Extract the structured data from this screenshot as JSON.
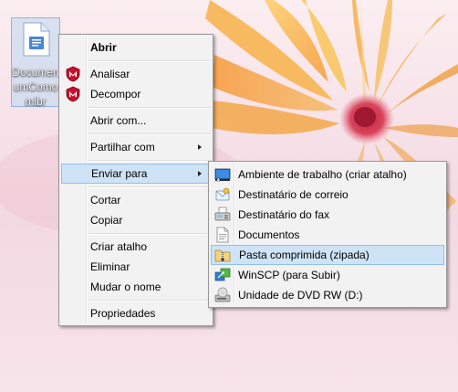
{
  "desktop": {
    "file_label_line1": "Documen",
    "file_label_line2": "umComo",
    "file_label_line3": "mibr"
  },
  "context_menu": {
    "items": [
      {
        "label": "Abrir",
        "icon": "none"
      },
      {
        "label": "Analisar",
        "icon": "mcafee-shield-icon"
      },
      {
        "label": "Decompor",
        "icon": "mcafee-shield-icon"
      },
      {
        "label": "Abrir com...",
        "icon": "none"
      },
      {
        "label": "Partilhar com",
        "icon": "none",
        "submenu": true
      },
      {
        "label": "Enviar para",
        "icon": "none",
        "submenu": true,
        "highlighted": true
      },
      {
        "label": "Cortar",
        "icon": "none"
      },
      {
        "label": "Copiar",
        "icon": "none"
      },
      {
        "label": "Criar atalho",
        "icon": "none"
      },
      {
        "label": "Eliminar",
        "icon": "none"
      },
      {
        "label": "Mudar o nome",
        "icon": "none"
      },
      {
        "label": "Propriedades",
        "icon": "none"
      }
    ]
  },
  "send_to_menu": {
    "items": [
      {
        "label": "Ambiente de trabalho (criar atalho)",
        "icon": "desktop-icon"
      },
      {
        "label": "Destinatário de correio",
        "icon": "mail-recipient-icon"
      },
      {
        "label": "Destinatário do fax",
        "icon": "fax-icon"
      },
      {
        "label": "Documentos",
        "icon": "documents-icon"
      },
      {
        "label": "Pasta comprimida (zipada)",
        "icon": "zip-folder-icon",
        "highlighted": true
      },
      {
        "label": "WinSCP (para Subir)",
        "icon": "winscp-icon"
      },
      {
        "label": "Unidade de DVD RW (D:)",
        "icon": "dvd-drive-icon"
      }
    ]
  },
  "colors": {
    "menu_background": "#f2f2f2",
    "highlight_fill": "#cfe3f6",
    "highlight_border": "#90c0ec",
    "selection_fill": "#bed7f0"
  }
}
